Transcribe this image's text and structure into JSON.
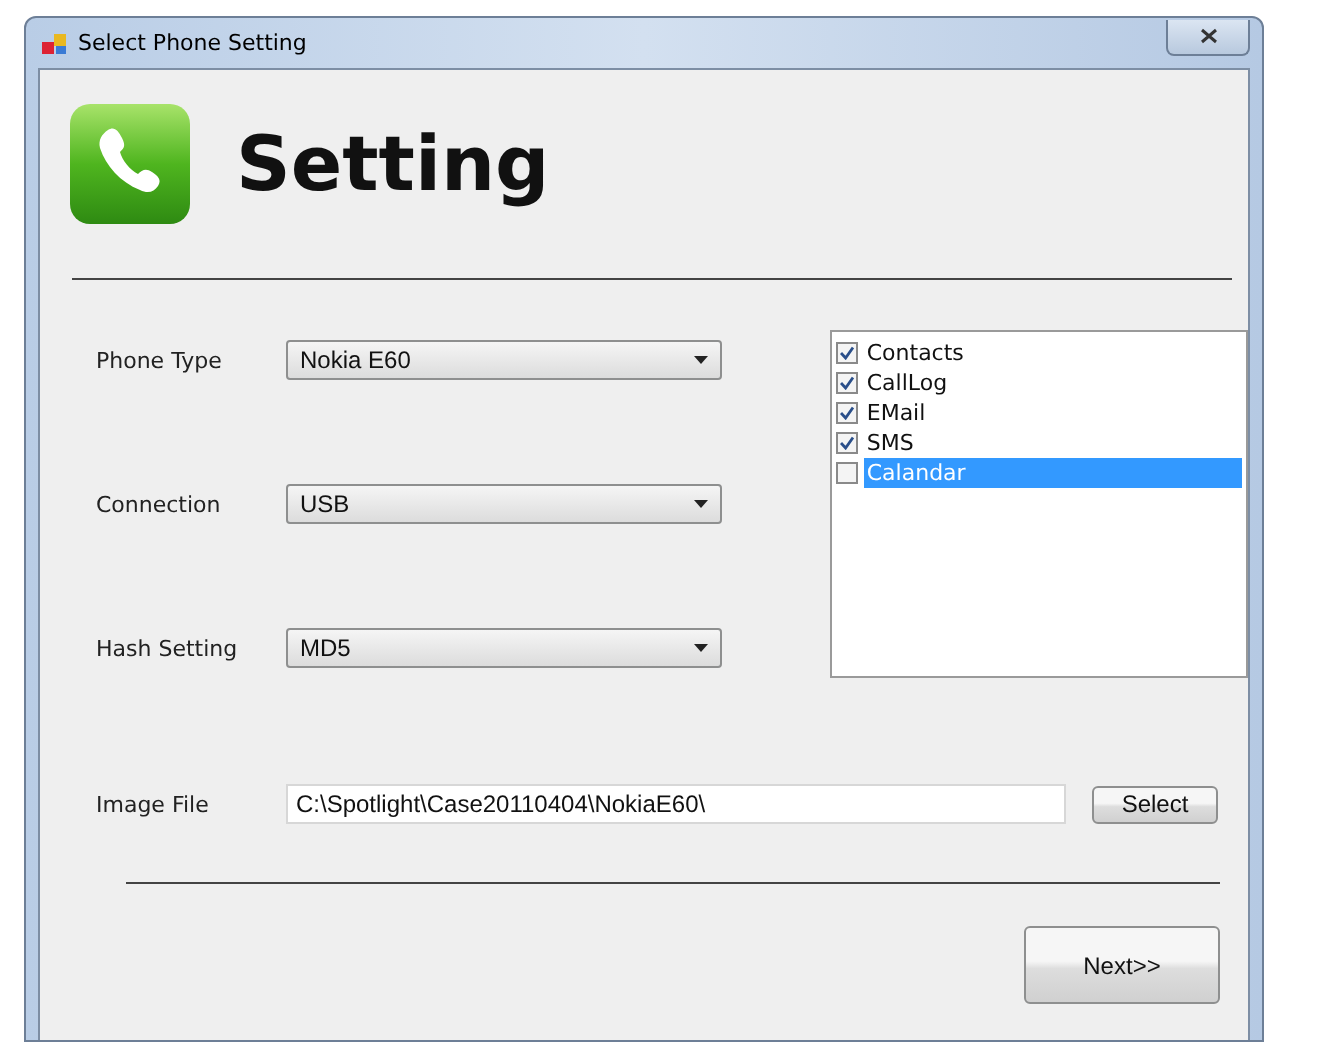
{
  "window": {
    "title": "Select Phone Setting"
  },
  "header": {
    "title": "Setting"
  },
  "fields": [
    {
      "kind": "dropdown",
      "label": "Phone Type",
      "value": "Nokia E60"
    },
    {
      "kind": "dropdown",
      "label": "Connection",
      "value": "USB"
    },
    {
      "kind": "dropdown",
      "label": "Hash Setting",
      "value": "MD5"
    }
  ],
  "data_types": [
    {
      "label": "Contacts",
      "checked": true,
      "selected": false
    },
    {
      "label": "CallLog",
      "checked": true,
      "selected": false
    },
    {
      "label": "EMail",
      "checked": true,
      "selected": false
    },
    {
      "label": "SMS",
      "checked": true,
      "selected": false
    },
    {
      "label": "Calandar",
      "checked": false,
      "selected": true
    }
  ],
  "image_file": {
    "label": "Image File",
    "value": "C:\\Spotlight\\Case20110404\\NokiaE60\\",
    "button": "Select"
  },
  "next_button": "Next>>"
}
